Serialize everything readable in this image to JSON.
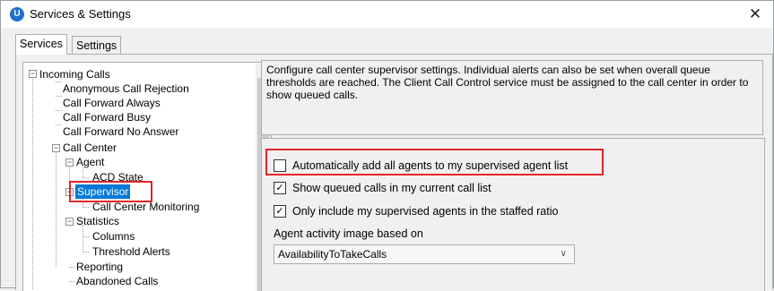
{
  "window": {
    "title": "Services & Settings",
    "app_icon_letter": "U",
    "close_glyph": "✕"
  },
  "tabs": [
    {
      "label": "Services",
      "active": true
    },
    {
      "label": "Settings",
      "active": false
    }
  ],
  "tree": {
    "scroll_up_glyph": "▲",
    "expander_glyph": "−",
    "nodes": [
      {
        "label": "Incoming Calls"
      },
      {
        "label": "Anonymous Call Rejection"
      },
      {
        "label": "Call Forward Always"
      },
      {
        "label": "Call Forward Busy"
      },
      {
        "label": "Call Forward No Answer"
      },
      {
        "label": "Call Center"
      },
      {
        "label": "Agent"
      },
      {
        "label": "ACD State"
      },
      {
        "label": "Supervisor",
        "selected": true
      },
      {
        "label": "Call Center Monitoring"
      },
      {
        "label": "Statistics"
      },
      {
        "label": "Columns"
      },
      {
        "label": "Threshold Alerts"
      },
      {
        "label": "Reporting"
      },
      {
        "label": "Abandoned Calls"
      }
    ]
  },
  "description": "Configure call center supervisor settings.  Individual alerts can also be set when overall queue thresholds are reached.  The Client Call Control service must be assigned to the call center in order to show queued calls.",
  "settings": {
    "checkboxes": [
      {
        "label": "Automatically add all agents to my supervised agent list",
        "checked": false,
        "mark": ""
      },
      {
        "label": "Show queued calls in my current call list",
        "checked": true,
        "mark": "✓"
      },
      {
        "label": "Only include my supervised agents in the staffed ratio",
        "checked": true,
        "mark": "✓"
      }
    ],
    "combo_label": "Agent activity image based on",
    "combo_value": "AvailabilityToTakeCalls",
    "combo_arrow": "∨"
  },
  "colors": {
    "selection": "#0078d7",
    "highlight": "#e0262b",
    "app_icon": "#1f6fd1"
  }
}
